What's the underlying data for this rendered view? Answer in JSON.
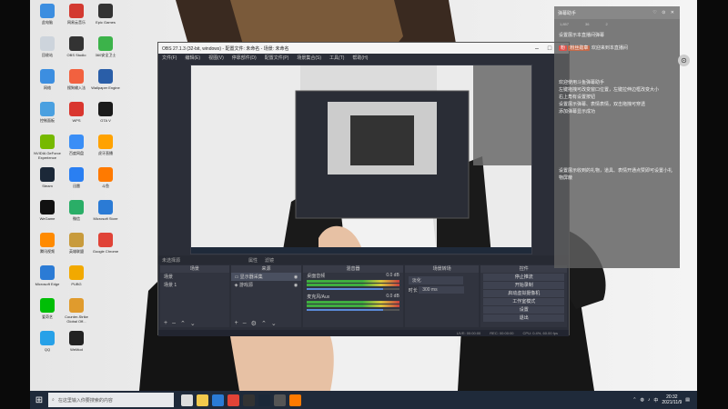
{
  "desktop_icons": [
    {
      "label": "此电脑",
      "color": "#3c8ee0"
    },
    {
      "label": "回收站",
      "color": "#cdd4dc"
    },
    {
      "label": "网络",
      "color": "#3c8ee0"
    },
    {
      "label": "控制面板",
      "color": "#4aa0e0"
    },
    {
      "label": "NVIDIA GeForce Experience",
      "color": "#76b900"
    },
    {
      "label": "Steam",
      "color": "#1b2838"
    },
    {
      "label": "WeGame",
      "color": "#111"
    },
    {
      "label": "腾讯视频",
      "color": "#ff8a00"
    },
    {
      "label": "Microsoft Edge",
      "color": "#2b7bd5"
    },
    {
      "label": "爱奇艺",
      "color": "#00be06"
    },
    {
      "label": "QQ",
      "color": "#27a1e8"
    },
    {
      "label": "网易云音乐",
      "color": "#d33a31"
    },
    {
      "label": "OBS Studio",
      "color": "#333"
    },
    {
      "label": "搜狗输入法",
      "color": "#f2613f"
    },
    {
      "label": "WPS",
      "color": "#d9362e"
    },
    {
      "label": "百度网盘",
      "color": "#3a8ef6"
    },
    {
      "label": "迅雷",
      "color": "#2a7ff2"
    },
    {
      "label": "微信",
      "color": "#2aae67"
    },
    {
      "label": "英雄联盟",
      "color": "#c89b3c"
    },
    {
      "label": "PUBG",
      "color": "#f2a900"
    },
    {
      "label": "Counter-Strike Global Off...",
      "color": "#e09b2d"
    },
    {
      "label": "WeMod",
      "color": "#222"
    },
    {
      "label": "Epic Games",
      "color": "#333"
    },
    {
      "label": "360安全卫士",
      "color": "#3cb34a"
    },
    {
      "label": "Wallpaper Engine",
      "color": "#2a5ea8"
    },
    {
      "label": "GTA V",
      "color": "#1a1a1a"
    },
    {
      "label": "虎牙直播",
      "color": "#ffa200"
    },
    {
      "label": "斗鱼",
      "color": "#ff7a00"
    },
    {
      "label": "Microsoft Store",
      "color": "#2b7bd5"
    },
    {
      "label": "Google Chrome",
      "color": "#e04337"
    }
  ],
  "obs": {
    "title": "OBS 27.1.3 (32-bit, windows) - 配置文件: 未命名 - 场景: 未命名",
    "menu": [
      "文件(F)",
      "编辑(E)",
      "视图(V)",
      "停靠部件(D)",
      "配置文件(P)",
      "场景集合(S)",
      "工具(T)",
      "帮助(H)"
    ],
    "scene_bar_label": "未选择源",
    "scene_bar_buttons": [
      "属性",
      "滤镜"
    ],
    "docks": {
      "scenes": {
        "header": "场景",
        "items": [
          "场景",
          "场景 1"
        ]
      },
      "sources": {
        "header": "来源",
        "items": [
          "显示器采集",
          "游戏源"
        ]
      },
      "mixer": {
        "header": "混音器",
        "channels": [
          {
            "name": "桌面音频",
            "value": "0.0 dB",
            "level": 0.82
          },
          {
            "name": "麦克风/Aux",
            "value": "0.0 dB",
            "level": 0.82
          }
        ]
      },
      "transitions": {
        "header": "场景转场",
        "type": "淡化",
        "duration_label": "时长",
        "duration_value": "300 ms"
      },
      "controls": {
        "header": "控件",
        "buttons": [
          "停止推流",
          "开始录制",
          "启动虚拟摄像机",
          "工作室模式",
          "设置",
          "退出"
        ]
      }
    },
    "status": [
      "LIVE: 00:00:00",
      "REC: 00:00:00",
      "CPU: 0.4%, 60.00 fps"
    ]
  },
  "panel": {
    "title": "弹幕助手",
    "header_icons": "♡ ⊙ ✕",
    "tabs": [
      "1,857",
      "36",
      "2"
    ],
    "messages": [
      {
        "text": "设置展示本直播间弹幕"
      },
      {
        "badge": "粉",
        "tag": "粉丝勋章",
        "text": "欢迎来到本直播间"
      },
      {
        "text": "欢迎使用斗鱼弹幕助手"
      },
      {
        "text": "左键拖拽可改变窗口位置，左键拉伸边框改变大小"
      },
      {
        "text": "右上角有设置按钮"
      },
      {
        "text": "设置展示弹幕、表情表情，双击拖拽可穿透"
      },
      {
        "text": "添加弹幕显示成功"
      },
      {
        "text": "设置展示收到的礼物，道具、表情开通点赞即可设置小礼物屏蔽"
      }
    ]
  },
  "taskbar": {
    "search_placeholder": "在这里输入你要搜索的内容",
    "time": "20:32",
    "date": "2021/11/9",
    "ime": "中",
    "apps": [
      {
        "name": "task-view",
        "color": "#ddd"
      },
      {
        "name": "file-explorer",
        "color": "#f2c94c"
      },
      {
        "name": "edge",
        "color": "#2b7bd5"
      },
      {
        "name": "chrome",
        "color": "#e04337"
      },
      {
        "name": "wegame",
        "color": "#333"
      },
      {
        "name": "steam",
        "color": "#1b2838"
      },
      {
        "name": "obs",
        "color": "#555"
      },
      {
        "name": "douyu",
        "color": "#ff7a00"
      }
    ]
  }
}
